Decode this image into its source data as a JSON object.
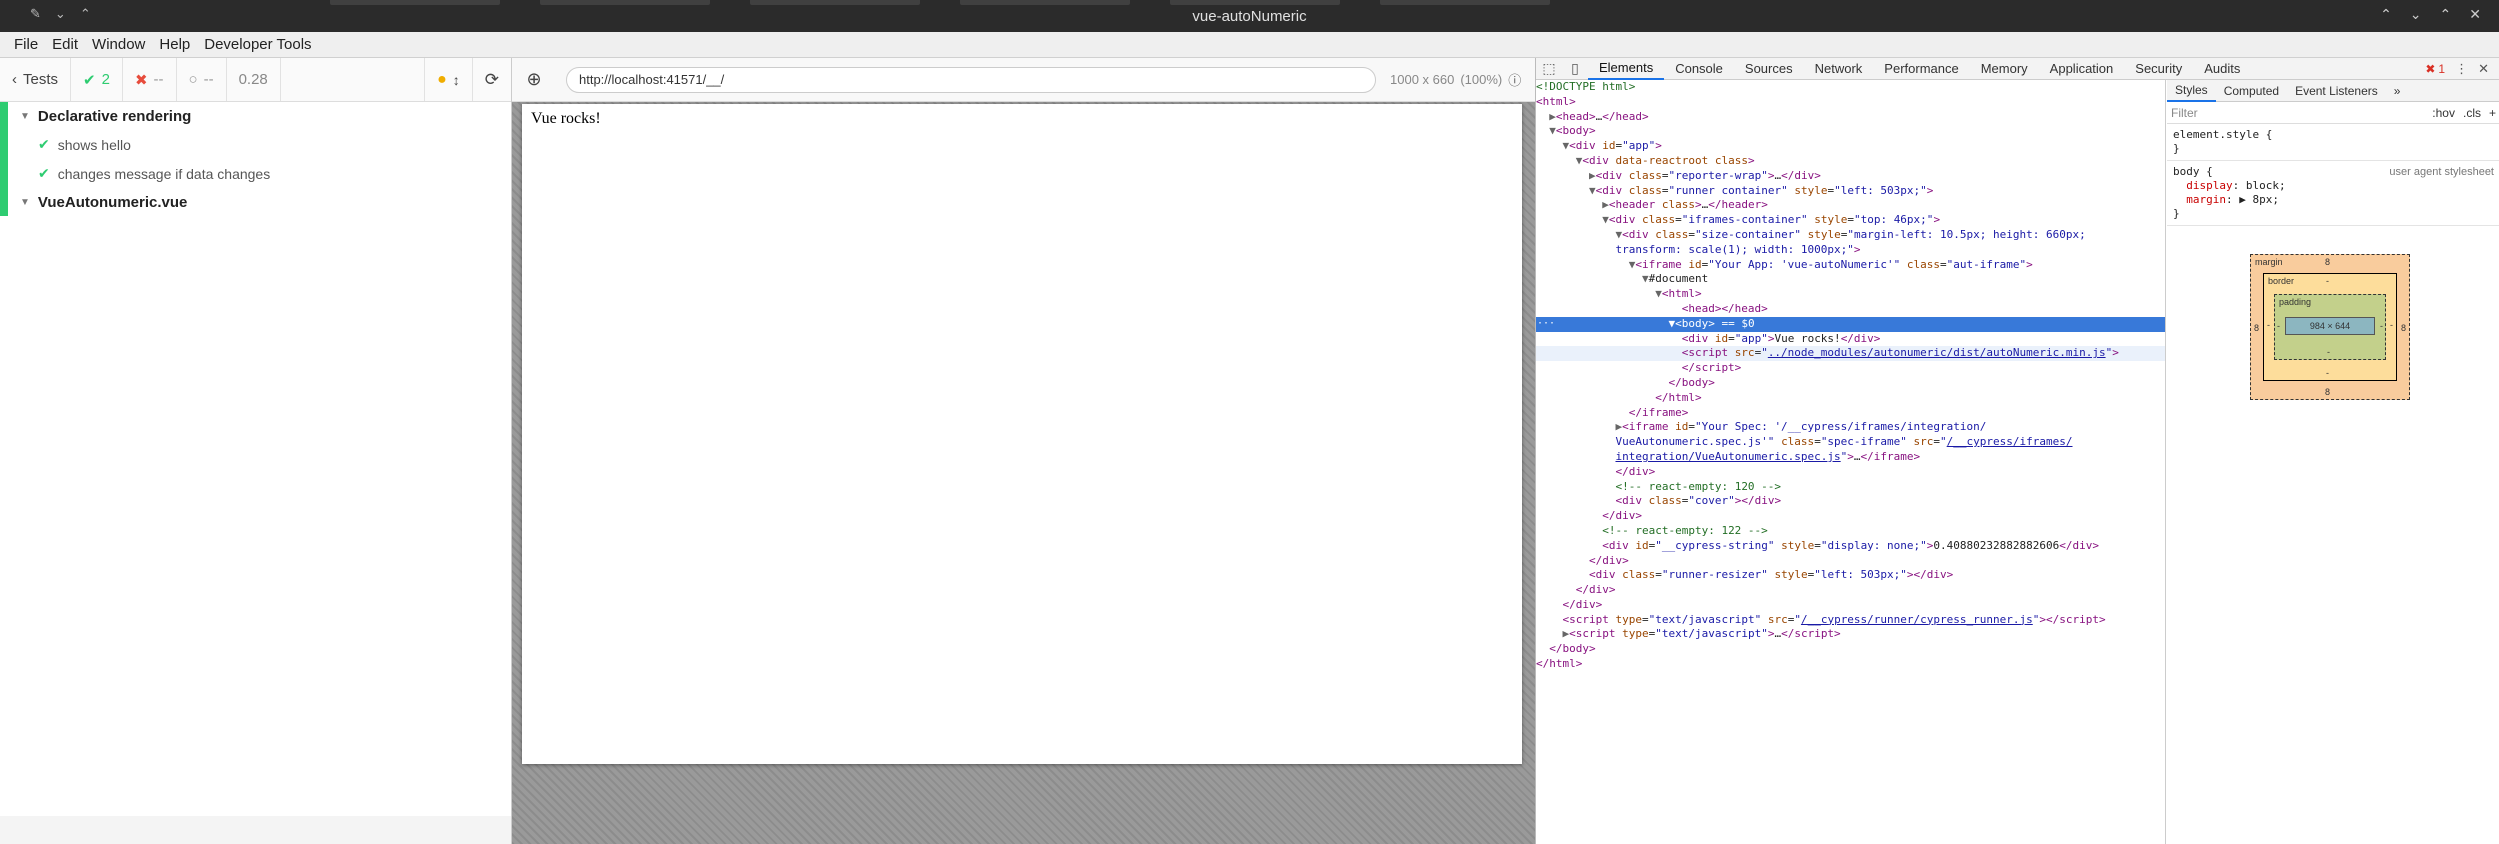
{
  "os": {
    "window_title": "vue-autoNumeric",
    "left_icons": [
      "✎",
      "⌄",
      "⌃"
    ],
    "right_icons": [
      "⌃",
      "⌄",
      "⌃",
      "✕"
    ]
  },
  "menubar": {
    "items": [
      "File",
      "Edit",
      "Window",
      "Help",
      "Developer Tools"
    ]
  },
  "reporter": {
    "tests_label": "Tests",
    "passed": "2",
    "failed": "--",
    "pending": "--",
    "duration": "0.28",
    "suites": [
      {
        "title": "Declarative rendering",
        "tests": [
          "shows hello",
          "changes message if data changes"
        ]
      },
      {
        "title": "VueAutonumeric.vue",
        "tests": []
      }
    ]
  },
  "runner": {
    "url": "http://localhost:41571/__/",
    "viewport": "1000 x 660",
    "zoom": "(100%)",
    "aut_text": "Vue rocks!"
  },
  "devtools": {
    "tabs": [
      "Elements",
      "Console",
      "Sources",
      "Network",
      "Performance",
      "Memory",
      "Application",
      "Security",
      "Audits"
    ],
    "active_tab": "Elements",
    "error_count": "1",
    "styles_tabs": [
      "Styles",
      "Computed",
      "Event Listeners"
    ],
    "filter_placeholder": "Filter",
    "filter_hov": ":hov",
    "filter_cls": ".cls",
    "element_style": "element.style {",
    "body_rule_selector": "body {",
    "body_rule_origin": "user agent stylesheet",
    "body_prop1_name": "display",
    "body_prop1_value": "block;",
    "body_prop2_name": "margin",
    "body_prop2_value": "▶ 8px;",
    "close_brace": "}",
    "boxmodel": {
      "margin_label": "margin",
      "border_label": "border",
      "padding_label": "padding",
      "margin_value": "8",
      "border_value": "-",
      "padding_value": "-",
      "content": "984 × 644"
    }
  }
}
